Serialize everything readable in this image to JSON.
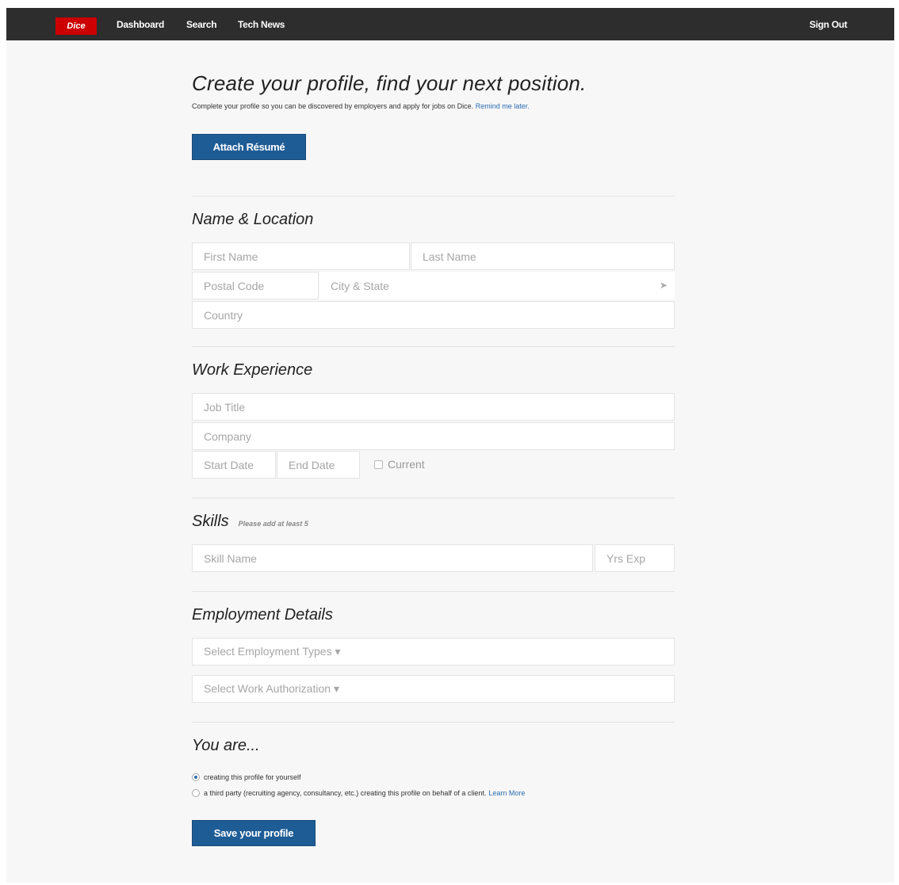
{
  "nav": {
    "logo": "Dice",
    "links": [
      "Dashboard",
      "Search",
      "Tech News"
    ],
    "sign_out": "Sign Out"
  },
  "header": {
    "title": "Create your profile, find your next position.",
    "intro": "Complete your profile so you can be discovered by employers and apply for jobs on Dice.",
    "remind_link": "Remind me later.",
    "attach_button": "Attach Résumé"
  },
  "name_location": {
    "title": "Name & Location",
    "first_name_placeholder": "First Name",
    "last_name_placeholder": "Last Name",
    "postal_code_placeholder": "Postal Code",
    "city_state_placeholder": "City & State",
    "country_placeholder": "Country"
  },
  "work_experience": {
    "title": "Work Experience",
    "job_title_placeholder": "Job Title",
    "company_placeholder": "Company",
    "start_date_placeholder": "Start Date",
    "end_date_placeholder": "End Date",
    "current_label": "Current"
  },
  "skills": {
    "title": "Skills",
    "hint": "Please add at least 5",
    "skill_name_placeholder": "Skill Name",
    "yrs_exp_placeholder": "Yrs Exp"
  },
  "employment_details": {
    "title": "Employment Details",
    "employment_types": "Select Employment Types",
    "work_authorization": "Select Work Authorization"
  },
  "you_are": {
    "title": "You are...",
    "option_self": "creating this profile for yourself",
    "option_third_party": "a third party (recruiting agency, consultancy, etc.) creating this profile on behalf of a client.",
    "learn_more": "Learn More",
    "selected": "self"
  },
  "save_button": "Save your profile",
  "colors": {
    "nav_bg": "#2d2d2d",
    "logo_red": "#cc0000",
    "button_blue": "#1e5c96",
    "link_blue": "#2a6db0"
  }
}
